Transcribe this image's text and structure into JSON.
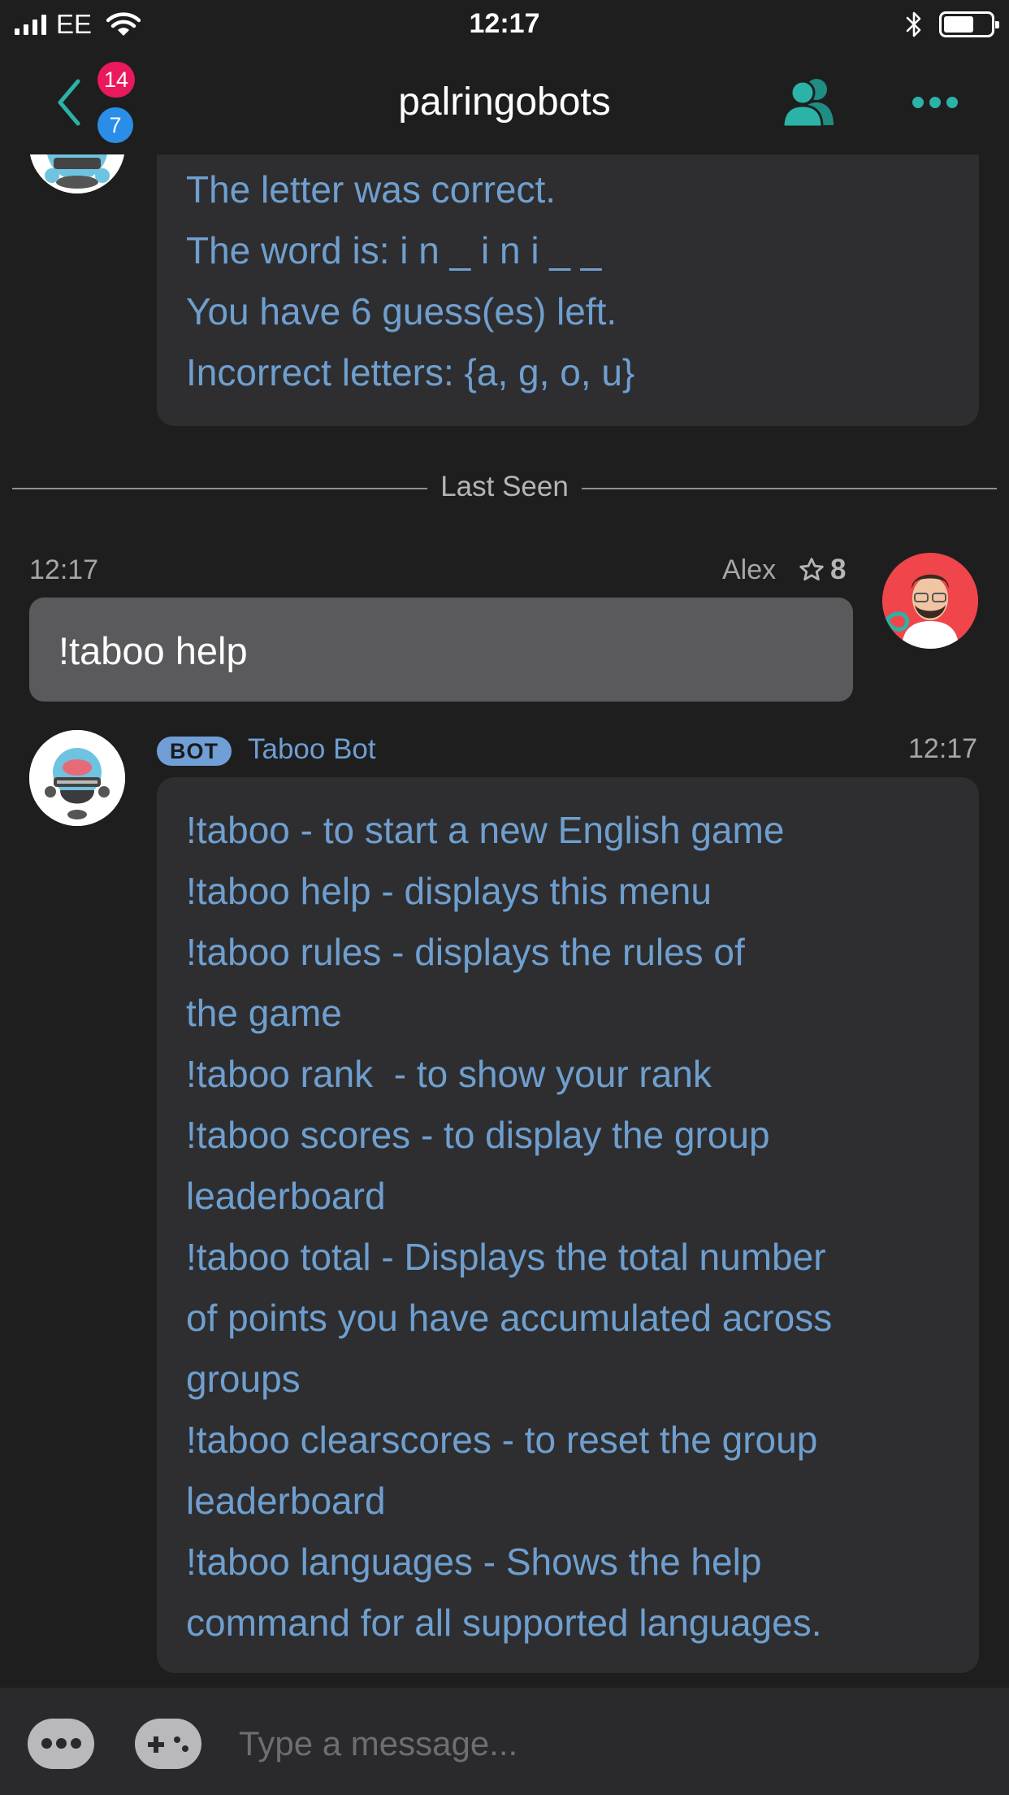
{
  "status_bar": {
    "carrier": "EE",
    "time": "12:17"
  },
  "header": {
    "title": "palringobots",
    "badge_top": "14",
    "badge_bottom": "7",
    "icons": [
      "back-chevron-icon",
      "members-icon",
      "more-dots-icon"
    ]
  },
  "messages": {
    "previous_bot": {
      "lines": "The letter was correct.\nThe word is: i n _ i n i _ _\nYou have 6 guess(es) left.\nIncorrect letters: {a, g, o, u}"
    },
    "divider_label": "Last Seen",
    "user_message": {
      "time": "12:17",
      "sender": "Alex",
      "reputation": "8",
      "text": "!taboo help"
    },
    "bot_message": {
      "tag": "BOT",
      "sender": "Taboo Bot",
      "time": "12:17",
      "text": "!taboo - to start a new English game\n!taboo help - displays this menu\n!taboo rules - displays the rules of\nthe game\n!taboo rank  - to show your rank\n!taboo scores - to display the group\nleaderboard\n!taboo total - Displays the total number\nof points you have accumulated across\ngroups\n!taboo clearscores - to reset the group\nleaderboard\n!taboo languages - Shows the help\ncommand for all supported languages."
    }
  },
  "input_bar": {
    "placeholder": "Type a message..."
  },
  "colors": {
    "background": "#1e1e1f",
    "bot_text": "#6f9fcf",
    "accent_teal": "#2ab3a6",
    "badge_red": "#e9195c",
    "badge_blue": "#2a8ee8"
  }
}
